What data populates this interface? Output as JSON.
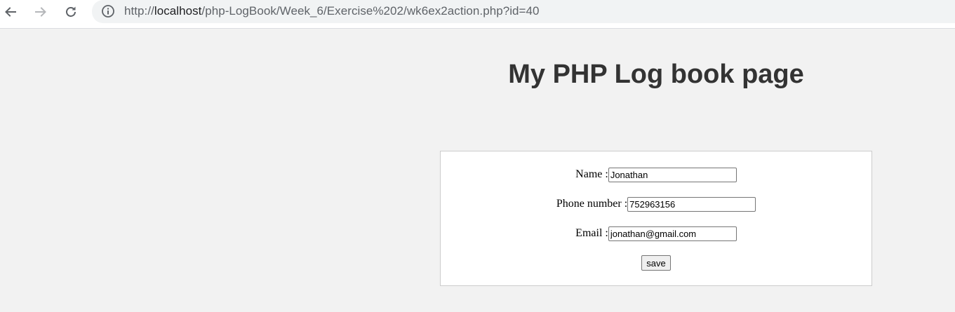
{
  "browser": {
    "url_scheme": "http://",
    "url_host": "localhost",
    "url_path": "/php-LogBook/Week_6/Exercise%202/wk6ex2action.php?id=40"
  },
  "page": {
    "title": "My PHP Log book page"
  },
  "form": {
    "name_label": "Name :",
    "name_value": "Jonathan",
    "phone_label": "Phone number :",
    "phone_value": "752963156",
    "email_label": "Email :",
    "email_value": "jonathan@gmail.com",
    "save_label": "save"
  },
  "colors": {
    "page_background": "#f2f2f2",
    "title_color": "#333333",
    "form_background": "#ffffff"
  },
  "icons": {
    "back": "arrow-left-icon",
    "forward": "arrow-right-icon",
    "reload": "reload-icon",
    "info": "info-circle-icon"
  }
}
